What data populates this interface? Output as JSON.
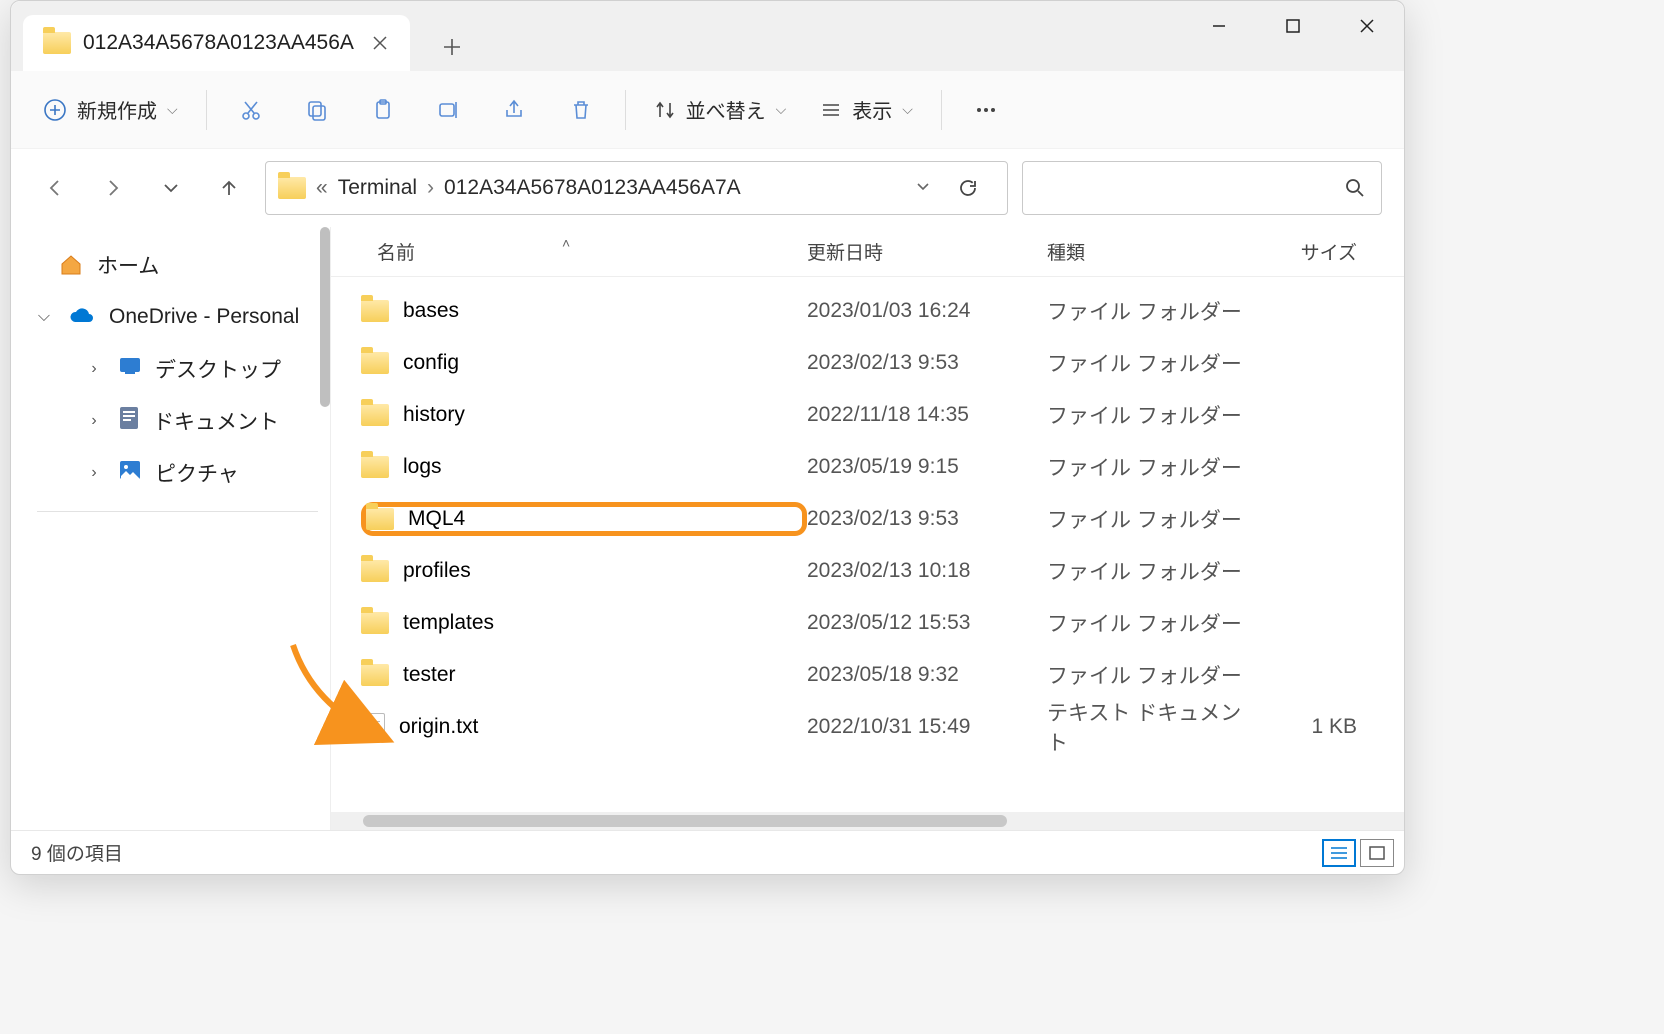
{
  "tab": {
    "title": "012A34A5678A0123AA456A"
  },
  "toolbar": {
    "new_label": "新規作成",
    "sort_label": "並べ替え",
    "view_label": "表示"
  },
  "breadcrumb": {
    "parent": "Terminal",
    "current": "012A34A5678A0123AA456A7A"
  },
  "sidebar": {
    "home": "ホーム",
    "onedrive": "OneDrive - Personal",
    "items": [
      {
        "label": "デスクトップ"
      },
      {
        "label": "ドキュメント"
      },
      {
        "label": "ピクチャ"
      }
    ]
  },
  "columns": {
    "name": "名前",
    "date": "更新日時",
    "type": "種類",
    "size": "サイズ"
  },
  "type_labels": {
    "folder": "ファイル フォルダー",
    "text": "テキスト ドキュメント"
  },
  "files": [
    {
      "name": "bases",
      "date": "2023/01/03 16:24",
      "type": "folder",
      "size": "",
      "highlight": false
    },
    {
      "name": "config",
      "date": "2023/02/13 9:53",
      "type": "folder",
      "size": "",
      "highlight": false
    },
    {
      "name": "history",
      "date": "2022/11/18 14:35",
      "type": "folder",
      "size": "",
      "highlight": false
    },
    {
      "name": "logs",
      "date": "2023/05/19 9:15",
      "type": "folder",
      "size": "",
      "highlight": false
    },
    {
      "name": "MQL4",
      "date": "2023/02/13 9:53",
      "type": "folder",
      "size": "",
      "highlight": true
    },
    {
      "name": "profiles",
      "date": "2023/02/13 10:18",
      "type": "folder",
      "size": "",
      "highlight": false
    },
    {
      "name": "templates",
      "date": "2023/05/12 15:53",
      "type": "folder",
      "size": "",
      "highlight": false
    },
    {
      "name": "tester",
      "date": "2023/05/18 9:32",
      "type": "folder",
      "size": "",
      "highlight": false
    },
    {
      "name": "origin.txt",
      "date": "2022/10/31 15:49",
      "type": "text",
      "size": "1 KB",
      "highlight": false
    }
  ],
  "status": {
    "count_label": "9 個の項目"
  }
}
